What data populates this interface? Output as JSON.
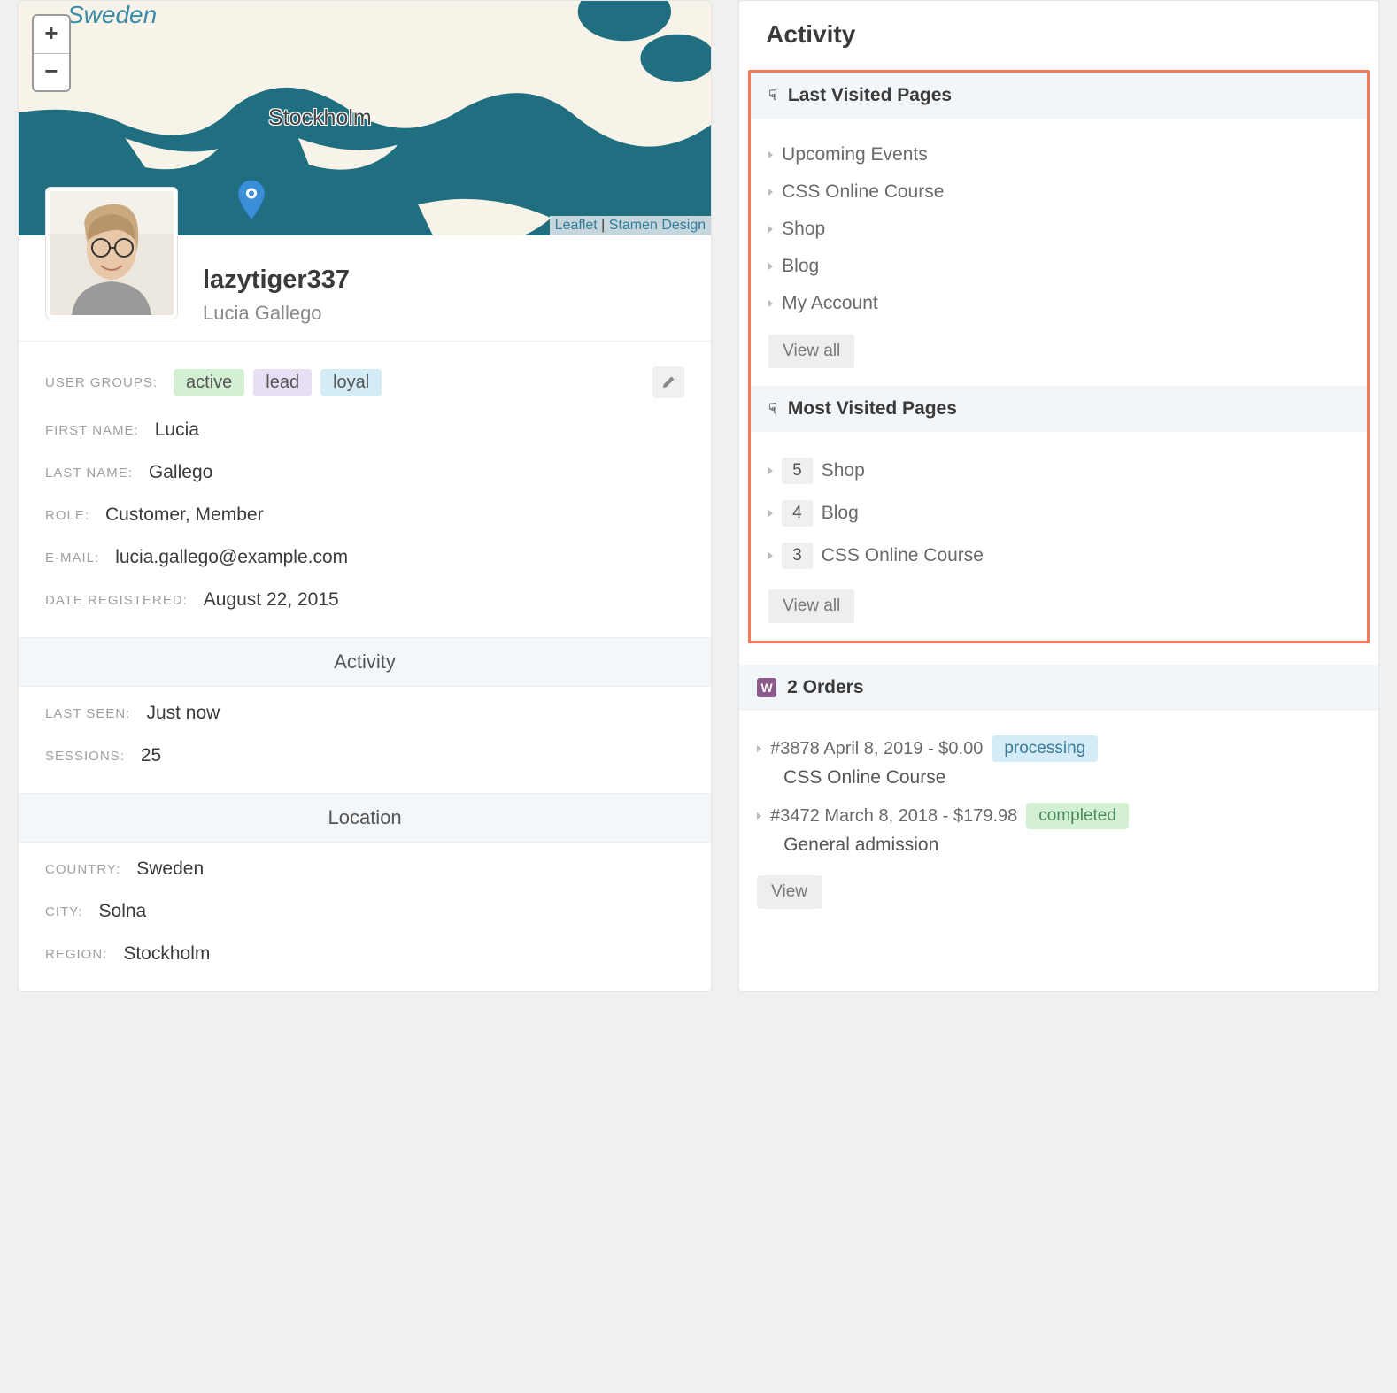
{
  "map": {
    "country": "Sweden",
    "city": "Stockholm",
    "zoom_in": "+",
    "zoom_out": "−",
    "attribution_leaflet": "Leaflet",
    "attribution_sep": " | ",
    "attribution_design": "Stamen Design"
  },
  "profile": {
    "username": "lazytiger337",
    "realname": "Lucia Gallego",
    "labels": {
      "user_groups": "User Groups:",
      "first_name": "First Name:",
      "last_name": "Last Name:",
      "role": "Role:",
      "email": "E-mail:",
      "date_registered": "Date Registered:"
    },
    "tags": {
      "active": "active",
      "lead": "lead",
      "loyal": "loyal"
    },
    "first_name": "Lucia",
    "last_name": "Gallego",
    "role": "Customer, Member",
    "email": "lucia.gallego@example.com",
    "date_registered": "August 22, 2015"
  },
  "activity_section": {
    "heading": "Activity",
    "labels": {
      "last_seen": "Last Seen:",
      "sessions": "Sessions:"
    },
    "last_seen": "Just now",
    "sessions": "25"
  },
  "location_section": {
    "heading": "Location",
    "labels": {
      "country": "Country:",
      "city": "City:",
      "region": "Region:"
    },
    "country": "Sweden",
    "city": "Solna",
    "region": "Stockholm"
  },
  "right": {
    "title": "Activity",
    "last_visited": {
      "heading": "Last Visited Pages",
      "items": [
        "Upcoming Events",
        "CSS Online Course",
        "Shop",
        "Blog",
        "My Account"
      ],
      "view_all": "View all"
    },
    "most_visited": {
      "heading": "Most Visited Pages",
      "items": [
        {
          "count": "5",
          "label": "Shop"
        },
        {
          "count": "4",
          "label": "Blog"
        },
        {
          "count": "3",
          "label": "CSS Online Course"
        }
      ],
      "view_all": "View all"
    },
    "orders": {
      "heading": "2 Orders",
      "w": "W",
      "items": [
        {
          "line": "#3878 April 8, 2019 - $0.00",
          "status": "processing",
          "status_class": "processing",
          "desc": "CSS Online Course"
        },
        {
          "line": "#3472 March 8, 2018 - $179.98",
          "status": "completed",
          "status_class": "completed",
          "desc": "General admission"
        }
      ],
      "view": "View"
    }
  }
}
